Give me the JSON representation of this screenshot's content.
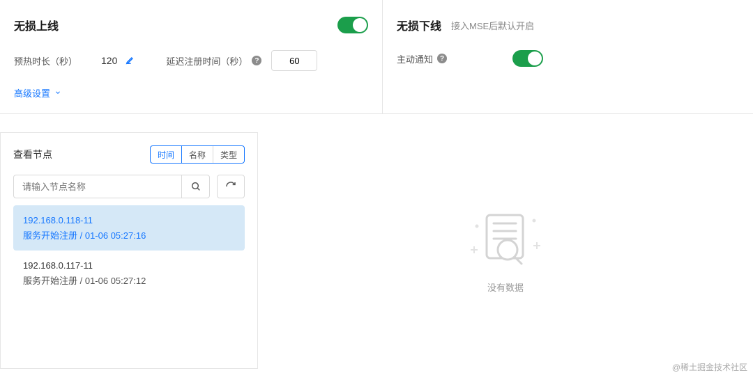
{
  "top": {
    "lossless_online": {
      "title": "无损上线",
      "toggle": true
    },
    "warmup": {
      "label": "预热时长（秒）",
      "value": "120"
    },
    "delay_reg": {
      "label": "延迟注册时间（秒）",
      "value": "60"
    },
    "advanced": {
      "label": "高级设置"
    },
    "lossless_offline": {
      "title": "无损下线",
      "subtitle": "接入MSE后默认开启"
    },
    "proactive_notify": {
      "label": "主动通知",
      "toggle": true
    }
  },
  "nodes": {
    "title": "查看节点",
    "tabs": [
      "时间",
      "名称",
      "类型"
    ],
    "search_placeholder": "请输入节点名称",
    "items": [
      {
        "ip": "192.168.0.118-11",
        "sub": "服务开始注册 / 01-06 05:27:16",
        "selected": true
      },
      {
        "ip": "192.168.0.117-11",
        "sub": "服务开始注册 / 01-06 05:27:12",
        "selected": false
      }
    ]
  },
  "detail": {
    "empty_text": "没有数据"
  },
  "watermark": "@稀土掘金技术社区"
}
